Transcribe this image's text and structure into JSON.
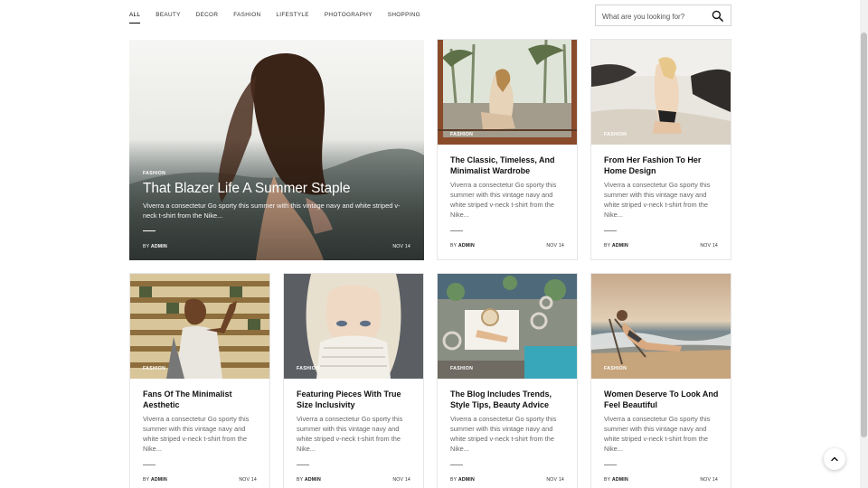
{
  "nav": {
    "items": [
      {
        "label": "ALL",
        "active": true
      },
      {
        "label": "BEAUTY",
        "active": false
      },
      {
        "label": "DECOR",
        "active": false
      },
      {
        "label": "FASHION",
        "active": false
      },
      {
        "label": "LIFESTYLE",
        "active": false
      },
      {
        "label": "PHOTOGRAPHY",
        "active": false
      },
      {
        "label": "SHOPPING",
        "active": false
      }
    ]
  },
  "search": {
    "placeholder": "What are you looking for?",
    "icon": "search-icon"
  },
  "hero": {
    "category": "FASHION",
    "title": "That Blazer Life A Summer Staple",
    "excerpt": "Viverra a consectetur Go sporty this summer with this vintage navy and white striped v-neck t-shirt from the Nike...",
    "by_prefix": "BY",
    "author": "ADMIN",
    "date": "NOV 14"
  },
  "posts": [
    {
      "category": "FASHION",
      "title": "The Classic, Timeless, And Minimalist Wardrobe",
      "excerpt": "Viverra a consectetur Go sporty this summer with this vintage navy and white striped v-neck t-shirt from the Nike...",
      "by_prefix": "BY",
      "author": "ADMIN",
      "date": "NOV 14"
    },
    {
      "category": "FASHION",
      "title": "From Her Fashion To Her Home Design",
      "excerpt": "Viverra a consectetur Go sporty this summer with this vintage navy and white striped v-neck t-shirt from the Nike...",
      "by_prefix": "BY",
      "author": "ADMIN",
      "date": "NOV 14"
    },
    {
      "category": "FASHION",
      "title": "Fans Of The Minimalist Aesthetic",
      "excerpt": "Viverra a consectetur Go sporty this summer with this vintage navy and white striped v-neck t-shirt from the Nike...",
      "by_prefix": "BY",
      "author": "ADMIN",
      "date": "NOV 14"
    },
    {
      "category": "FASHION",
      "title": "Featuring Pieces With True Size Inclusivity",
      "excerpt": "Viverra a consectetur Go sporty this summer with this vintage navy and white striped v-neck t-shirt from the Nike...",
      "by_prefix": "BY",
      "author": "ADMIN",
      "date": "NOV 14"
    },
    {
      "category": "FASHION",
      "title": "The Blog Includes Trends, Style Tips, Beauty Advice",
      "excerpt": "Viverra a consectetur Go sporty this summer with this vintage navy and white striped v-neck t-shirt from the Nike...",
      "by_prefix": "BY",
      "author": "ADMIN",
      "date": "NOV 14"
    },
    {
      "category": "FASHION",
      "title": "Women Deserve To Look And Feel Beautiful",
      "excerpt": "Viverra a consectetur Go sporty this summer with this vintage navy and white striped v-neck t-shirt from the Nike...",
      "by_prefix": "BY",
      "author": "ADMIN",
      "date": "NOV 14"
    }
  ],
  "back_to_top": {
    "icon": "chevron-up-icon"
  }
}
